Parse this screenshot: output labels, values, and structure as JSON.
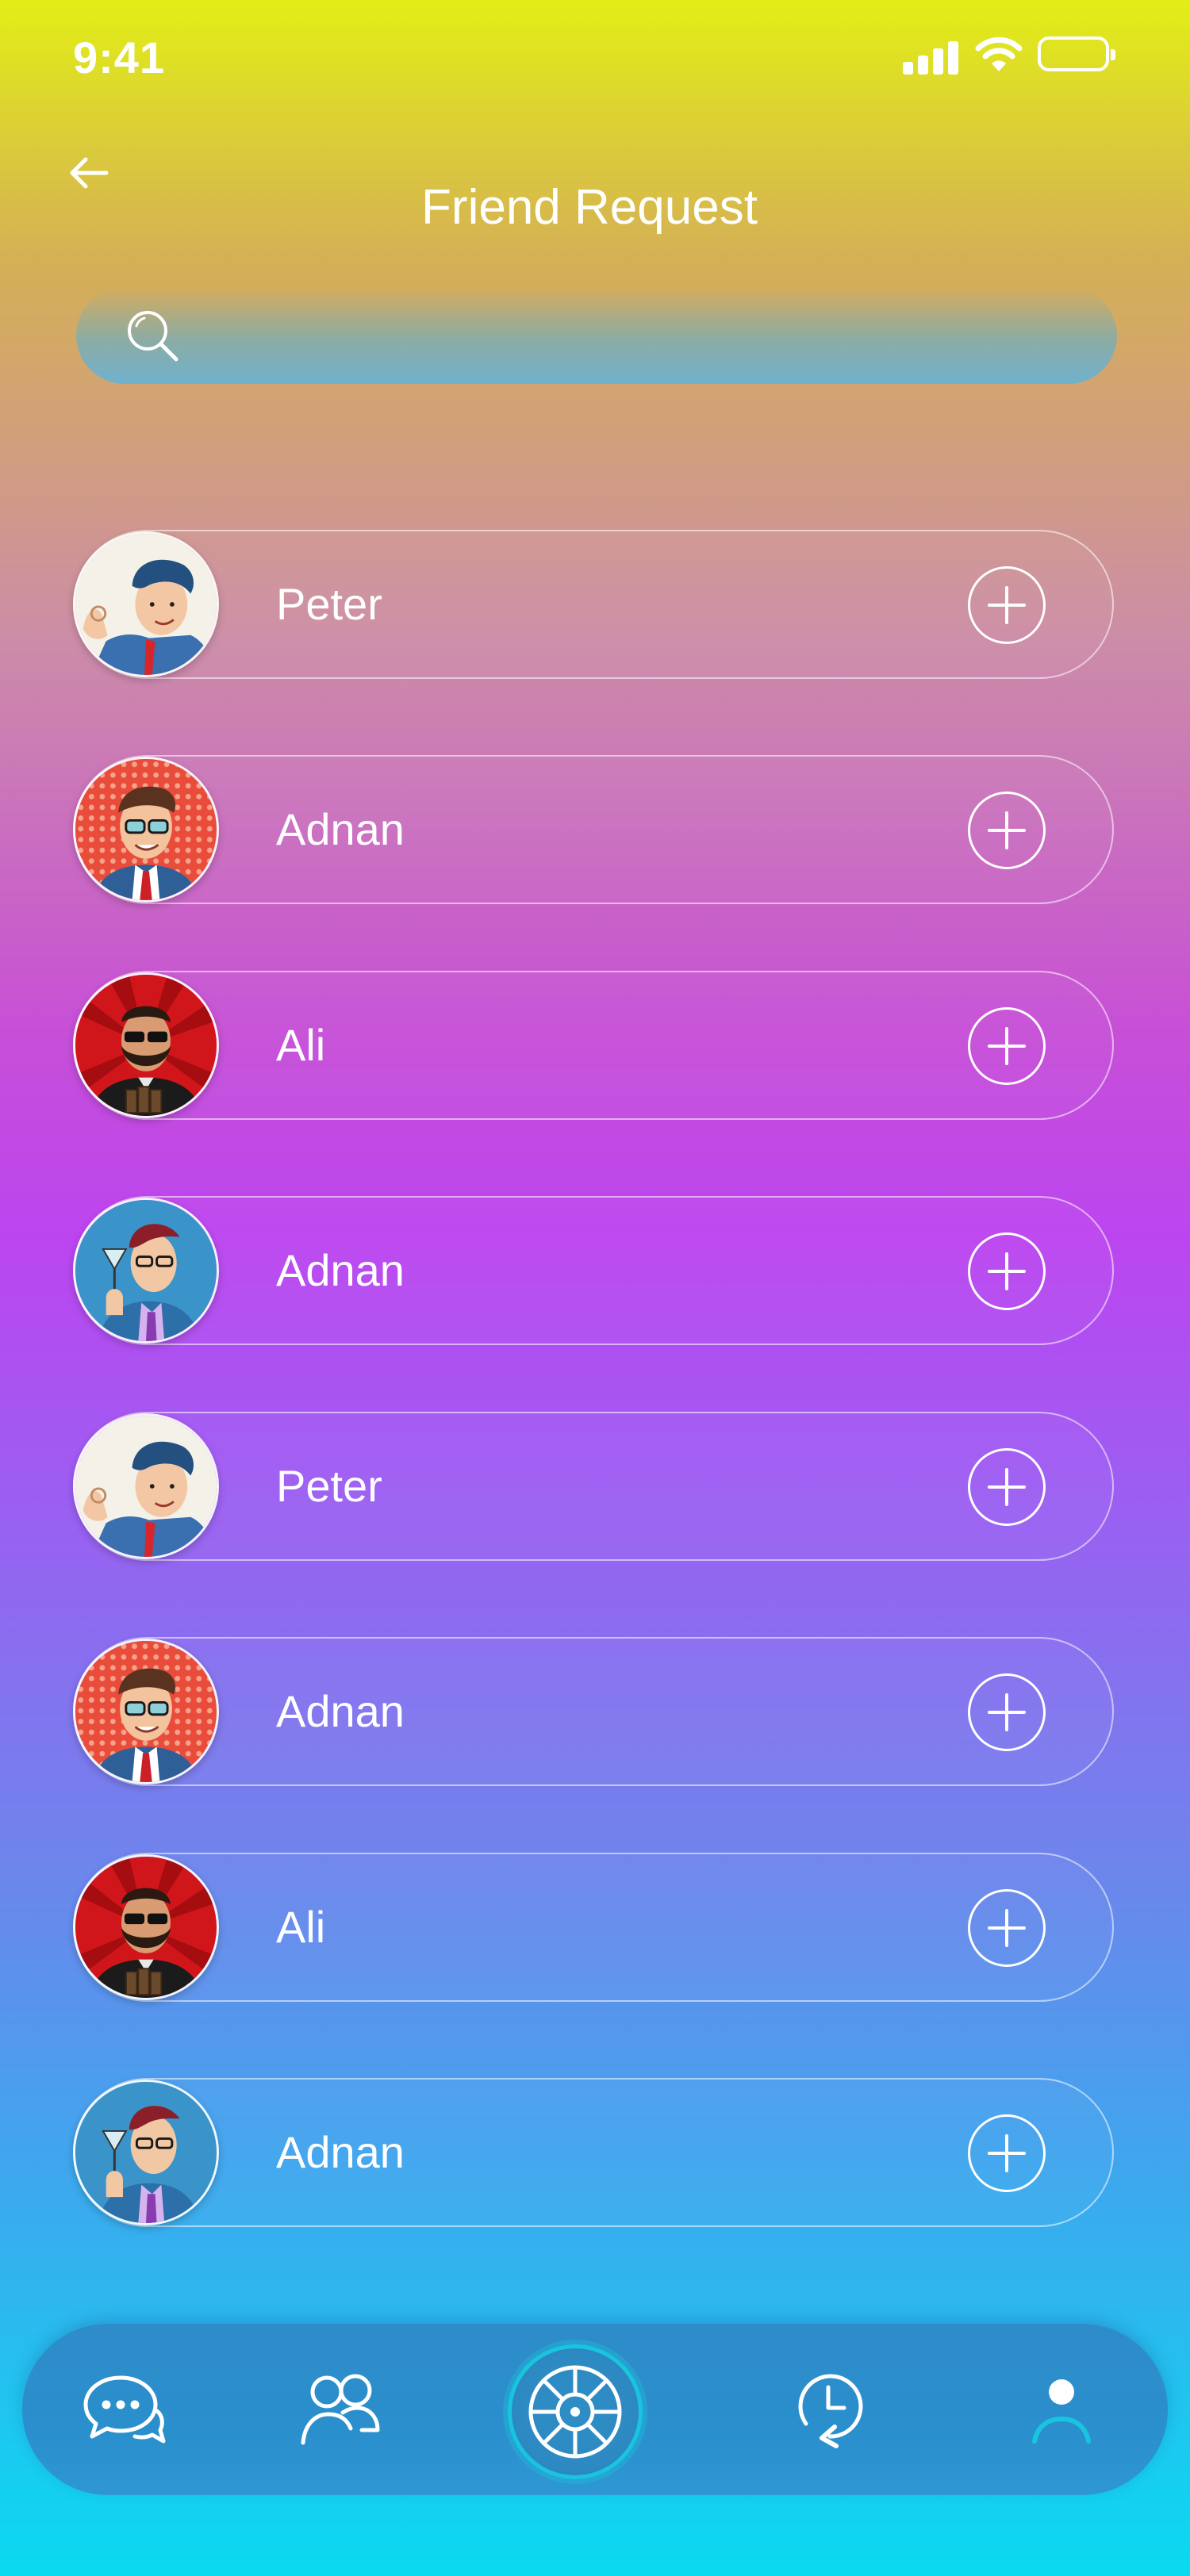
{
  "status_bar": {
    "time": "9:41"
  },
  "header": {
    "title": "Friend Request"
  },
  "search": {
    "placeholder": ""
  },
  "friends": [
    {
      "name": "Peter",
      "avatar": "pop-art-man-ok-gesture"
    },
    {
      "name": "Adnan",
      "avatar": "pop-art-man-glasses-red-dots"
    },
    {
      "name": "Ali",
      "avatar": "pop-art-bearded-man-sunglasses"
    },
    {
      "name": "Adnan",
      "avatar": "pop-art-man-cocktail"
    },
    {
      "name": "Peter",
      "avatar": "pop-art-man-ok-gesture"
    },
    {
      "name": "Adnan",
      "avatar": "pop-art-man-glasses-red-dots"
    },
    {
      "name": "Ali",
      "avatar": "pop-art-bearded-man-sunglasses"
    },
    {
      "name": "Adnan",
      "avatar": "pop-art-man-cocktail"
    }
  ],
  "bottom_nav": {
    "items": [
      "chat-icon",
      "friends-icon",
      "wheel-icon",
      "history-icon",
      "profile-icon"
    ],
    "active": "profile-icon"
  },
  "colors": {
    "accent": "#19c5de",
    "nav_bg": "#2a8fcc"
  }
}
